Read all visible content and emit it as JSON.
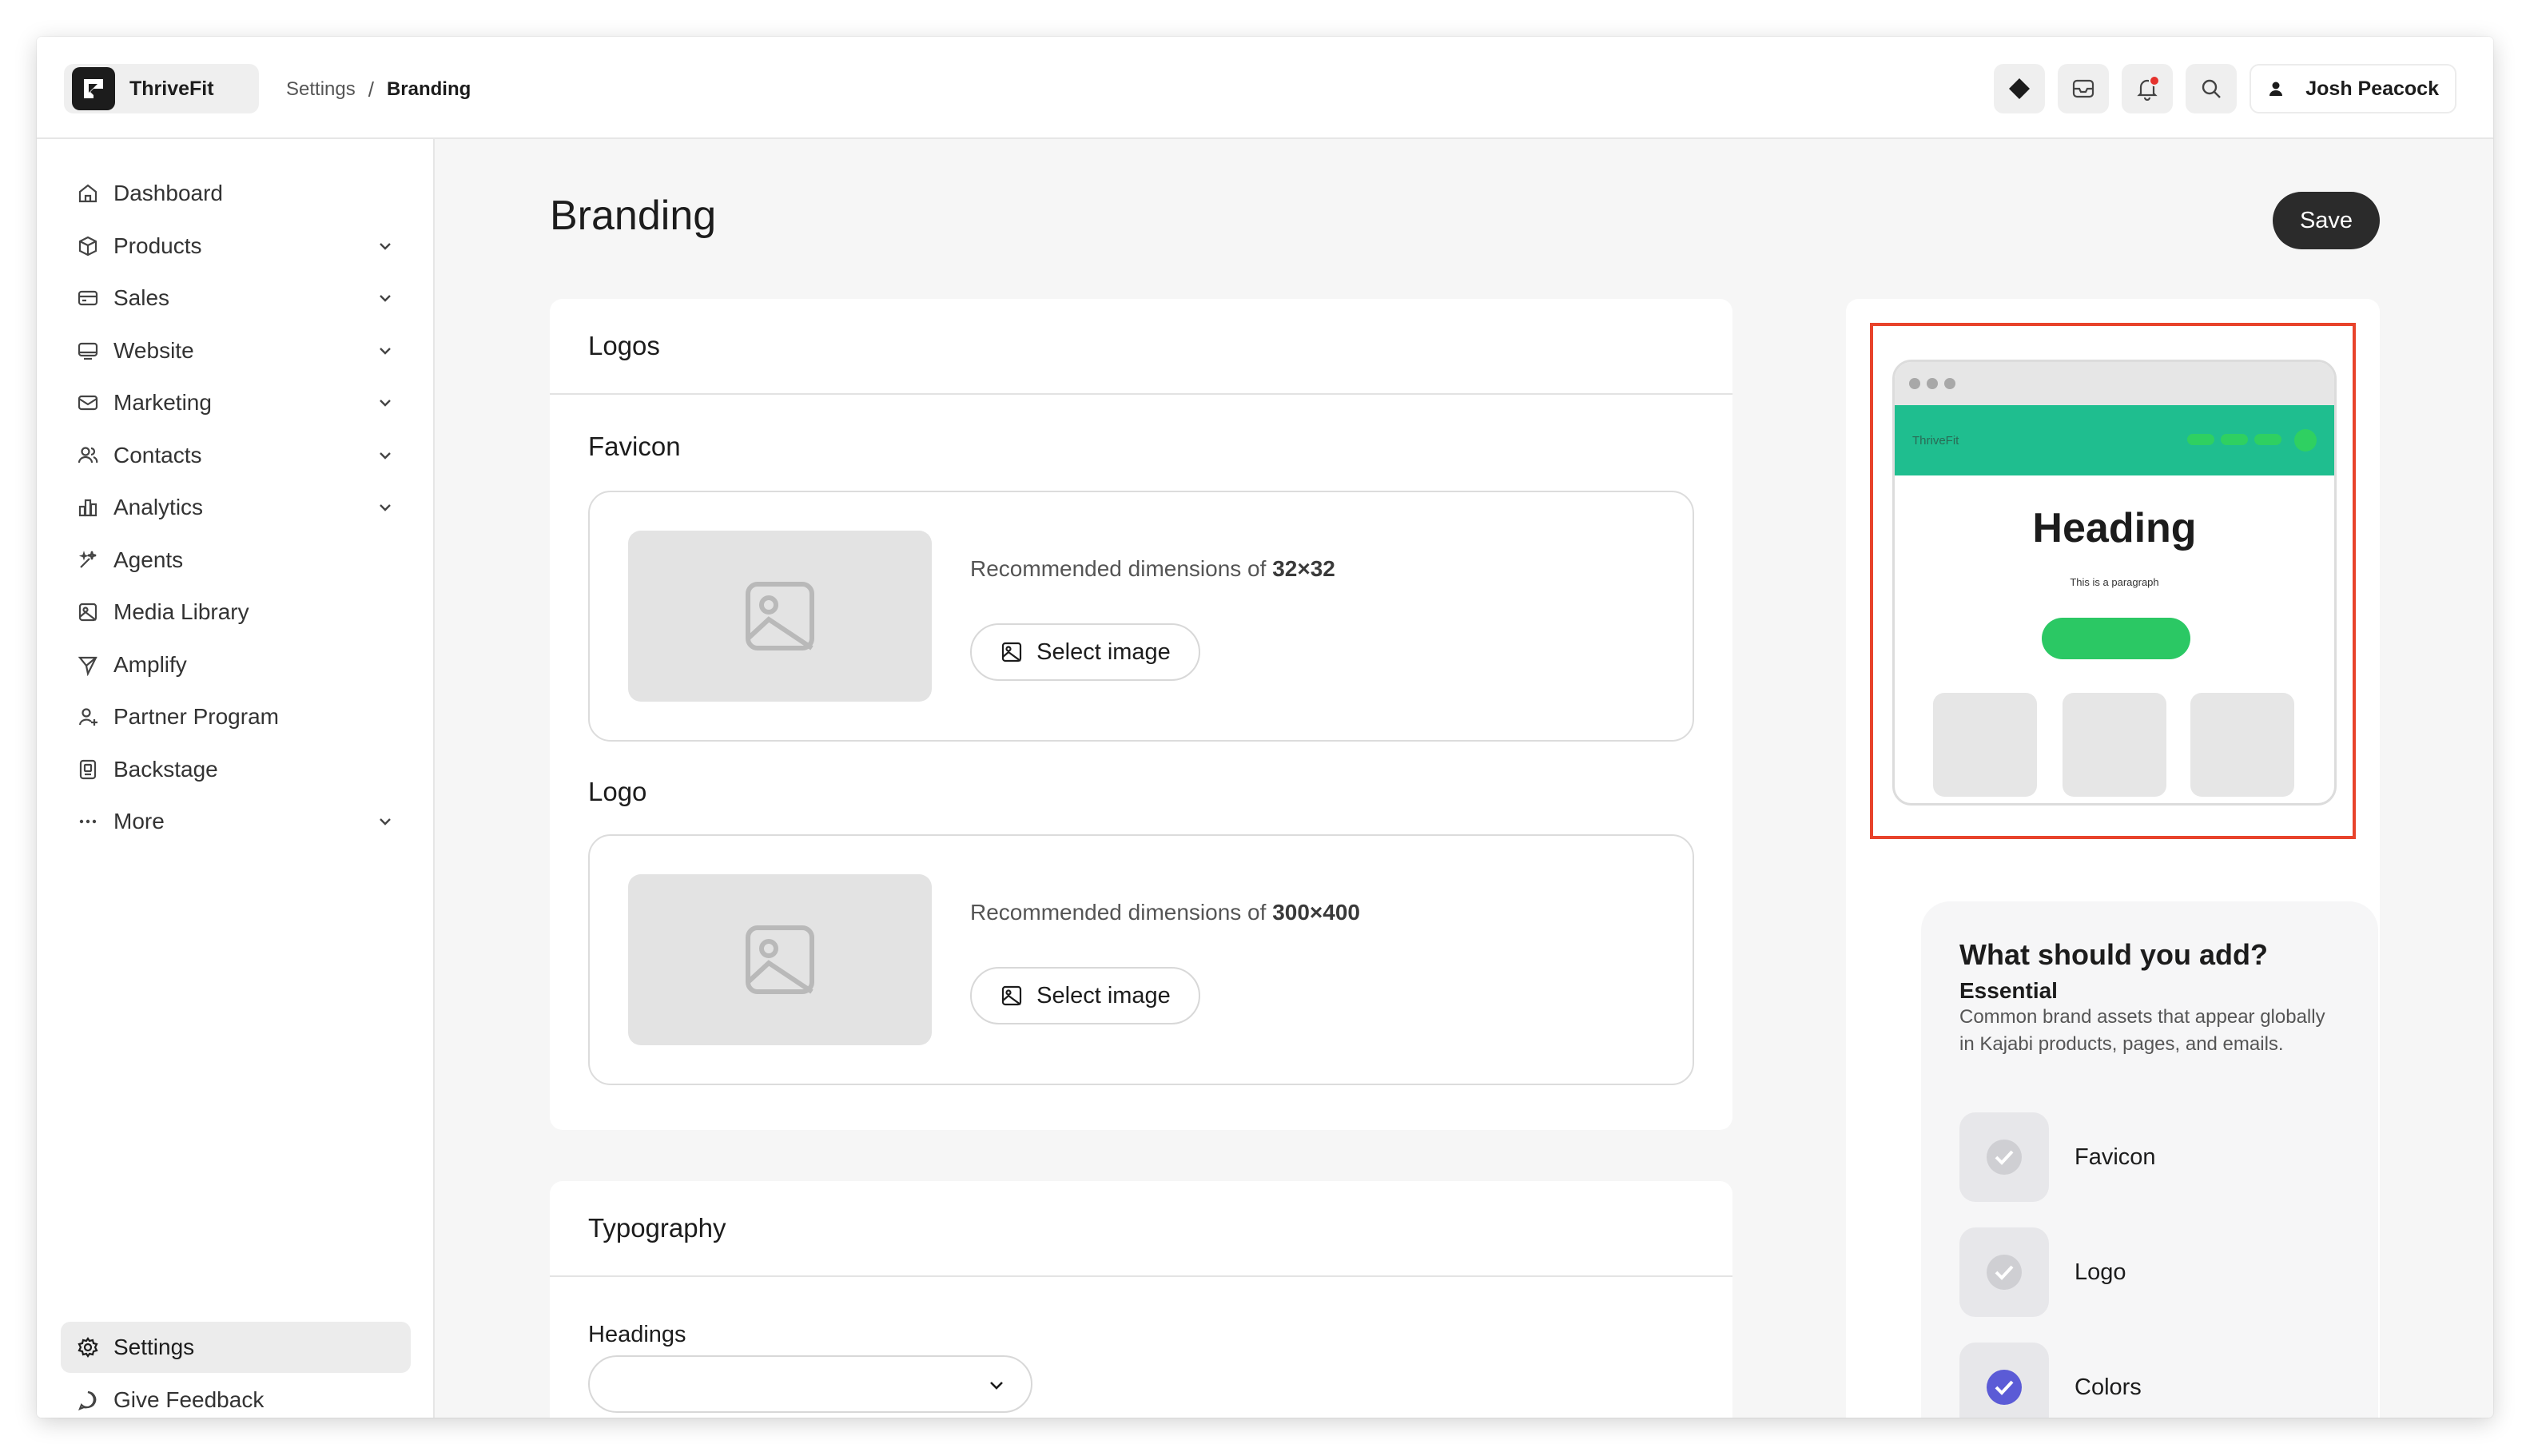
{
  "app": {
    "brand": "ThriveFit",
    "user_name": "Josh Peacock"
  },
  "breadcrumb": {
    "parent": "Settings",
    "separator": "/",
    "current": "Branding"
  },
  "sidebar": {
    "items": [
      {
        "label": "Dashboard",
        "icon": "home-icon",
        "expandable": false
      },
      {
        "label": "Products",
        "icon": "box-icon",
        "expandable": true
      },
      {
        "label": "Sales",
        "icon": "credit-card-icon",
        "expandable": true
      },
      {
        "label": "Website",
        "icon": "monitor-icon",
        "expandable": true
      },
      {
        "label": "Marketing",
        "icon": "mail-icon",
        "expandable": true
      },
      {
        "label": "Contacts",
        "icon": "users-icon",
        "expandable": true
      },
      {
        "label": "Analytics",
        "icon": "bar-chart-icon",
        "expandable": true
      },
      {
        "label": "Agents",
        "icon": "sparkle-wand-icon",
        "expandable": false
      },
      {
        "label": "Media Library",
        "icon": "image-icon",
        "expandable": false
      },
      {
        "label": "Amplify",
        "icon": "send-icon",
        "expandable": false
      },
      {
        "label": "Partner Program",
        "icon": "user-plus-icon",
        "expandable": false
      },
      {
        "label": "Backstage",
        "icon": "badge-icon",
        "expandable": false
      },
      {
        "label": "More",
        "icon": "dots-icon",
        "expandable": true
      }
    ],
    "bottom": [
      {
        "label": "Settings",
        "icon": "gear-icon",
        "active": true
      },
      {
        "label": "Give Feedback",
        "icon": "message-icon",
        "active": false
      }
    ]
  },
  "page": {
    "title": "Branding",
    "save_label": "Save"
  },
  "logos_card": {
    "title": "Logos",
    "favicon": {
      "label": "Favicon",
      "rec_prefix": "Recommended dimensions of ",
      "rec_value": "32×32",
      "button": "Select image"
    },
    "logo": {
      "label": "Logo",
      "rec_prefix": "Recommended dimensions of ",
      "rec_value": "300×400",
      "button": "Select image"
    }
  },
  "typography_card": {
    "title": "Typography",
    "headings_label": "Headings",
    "headings_value": ""
  },
  "preview": {
    "brand": "ThriveFit",
    "heading": "Heading",
    "paragraph": "This is a paragraph"
  },
  "tips": {
    "title": "What should you add?",
    "subtitle": "Essential",
    "description": "Common brand assets that appear globally in Kajabi products, pages, and emails.",
    "items": [
      {
        "label": "Favicon",
        "done": false
      },
      {
        "label": "Logo",
        "done": false
      },
      {
        "label": "Colors",
        "done": true
      }
    ]
  },
  "colors": {
    "accent": "#5b5bd6",
    "highlight": "#e8432b",
    "preview_header": "#1fbe8f",
    "preview_cta": "#2bc864"
  }
}
